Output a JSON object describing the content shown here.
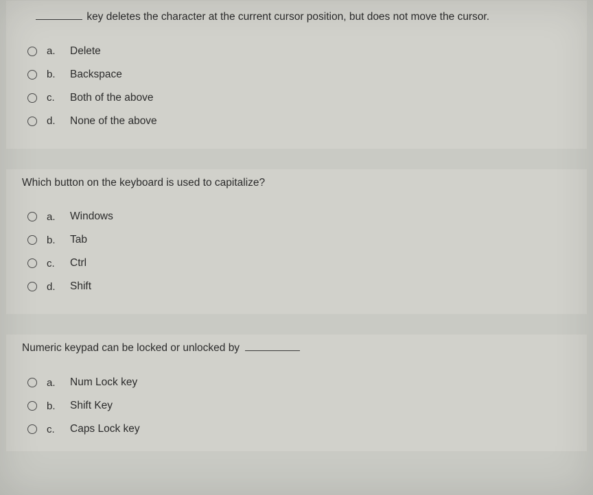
{
  "questions": [
    {
      "text_prefix_blank": true,
      "text": "key deletes the character at the current cursor position, but does not move the cursor.",
      "options": [
        {
          "letter": "a.",
          "label": "Delete"
        },
        {
          "letter": "b.",
          "label": "Backspace"
        },
        {
          "letter": "c.",
          "label": "Both of the above"
        },
        {
          "letter": "d.",
          "label": "None of the above"
        }
      ]
    },
    {
      "text": "Which button on the keyboard is used to capitalize?",
      "options": [
        {
          "letter": "a.",
          "label": "Windows"
        },
        {
          "letter": "b.",
          "label": "Tab"
        },
        {
          "letter": "c.",
          "label": "Ctrl"
        },
        {
          "letter": "d.",
          "label": "Shift"
        }
      ]
    },
    {
      "text": "Numeric keypad can be locked or unlocked by",
      "text_suffix_blank": true,
      "options": [
        {
          "letter": "a.",
          "label": "Num Lock key"
        },
        {
          "letter": "b.",
          "label": "Shift Key"
        },
        {
          "letter": "c.",
          "label": "Caps Lock key"
        }
      ]
    }
  ]
}
